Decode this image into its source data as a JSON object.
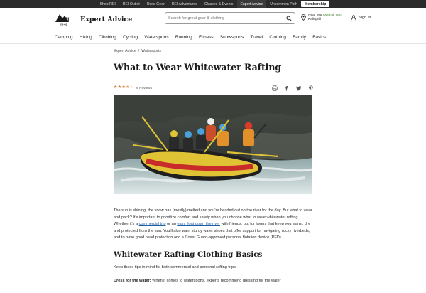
{
  "topbar": {
    "links": [
      "Shop REI",
      "REI Outlet",
      "Used Gear",
      "REI Adventures",
      "Classes & Events",
      "Expert Advice",
      "Uncommon Path",
      "Membership"
    ]
  },
  "header": {
    "logo_mark": "REI co-op",
    "logo_text": "Expert Advice",
    "search_placeholder": "Search for great gear & clothing",
    "store_near": "Near you",
    "store_open": "Open til 8pm",
    "store_location": "Kalispell",
    "signin": "Sign In"
  },
  "nav": {
    "items": [
      "Camping",
      "Hiking",
      "Climbing",
      "Cycling",
      "Watersports",
      "Running",
      "Fitness",
      "Snowsports",
      "Travel",
      "Clothing",
      "Family",
      "Basics"
    ]
  },
  "breadcrumb": {
    "home": "Expert Advice",
    "separator": "/",
    "current": "Watersports"
  },
  "article": {
    "title": "What to Wear Whitewater Rafting",
    "rating": 3.5,
    "reviews": "6 Reviews",
    "intro_1": "The sun is shining, the snow has (mostly) melted and you're headed out on the river for the day. But what to wear and pack? It's important to prioritize comfort and safety when you choose what to wear whitewater rafting. Whether it's a ",
    "intro_link_1": "commercial trip",
    "intro_2": " or an ",
    "intro_link_2": "easy float down the river",
    "intro_3": " with friends, opt for layers that keep you warm, dry and protected from the sun. You'll also want sturdy water shoes that offer support for navigating rocky riverbeds, and to have good head protection and a Coast Guard-approved personal flotation device (PFD).",
    "section_title": "Whitewater Rafting Clothing Basics",
    "section_intro": "Keep these tips in mind for both commercial and personal rafting trips.",
    "tip_label": "Dress for the water:",
    "tip_text": " When it comes to watersports, experts recommend dressing for the water"
  },
  "icons": {
    "search": "search-icon",
    "pin": "map-pin-icon",
    "user": "user-icon",
    "print": "print-icon",
    "facebook": "facebook-icon",
    "twitter": "twitter-icon",
    "pinterest": "pinterest-icon"
  },
  "colors": {
    "topbar_bg": "#2b2b2b",
    "link": "#1f5fa8",
    "open_status": "#3b7d23",
    "star": "#c97a2a"
  }
}
